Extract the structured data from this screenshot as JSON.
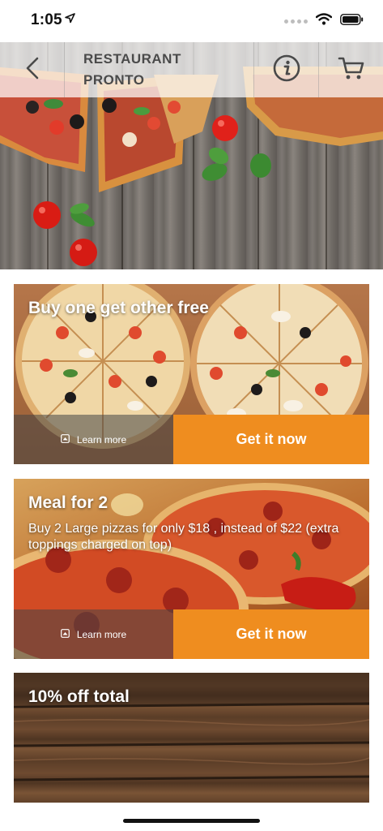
{
  "status_bar": {
    "time": "1:05",
    "icons": [
      "location-arrow-icon",
      "signal-icon",
      "wifi-icon",
      "battery-icon"
    ]
  },
  "nav": {
    "title_line1": "RESTAURANT",
    "title_line2": "PRONTO",
    "icons": [
      "back-chevron-icon",
      "info-icon",
      "cart-icon"
    ]
  },
  "colors": {
    "accent": "#ef8d1f",
    "nav_text": "#4a4a4a",
    "white": "#ffffff"
  },
  "offers": [
    {
      "title": "Buy one get other free",
      "description": "",
      "learn_more": "Learn more",
      "cta": "Get it now"
    },
    {
      "title": "Meal for 2",
      "description": "Buy 2 Large pizzas for only $18 , instead of $22 (extra toppings charged on top)",
      "learn_more": "Learn more",
      "cta": "Get it now"
    },
    {
      "title": "10% off total",
      "description": ""
    }
  ]
}
